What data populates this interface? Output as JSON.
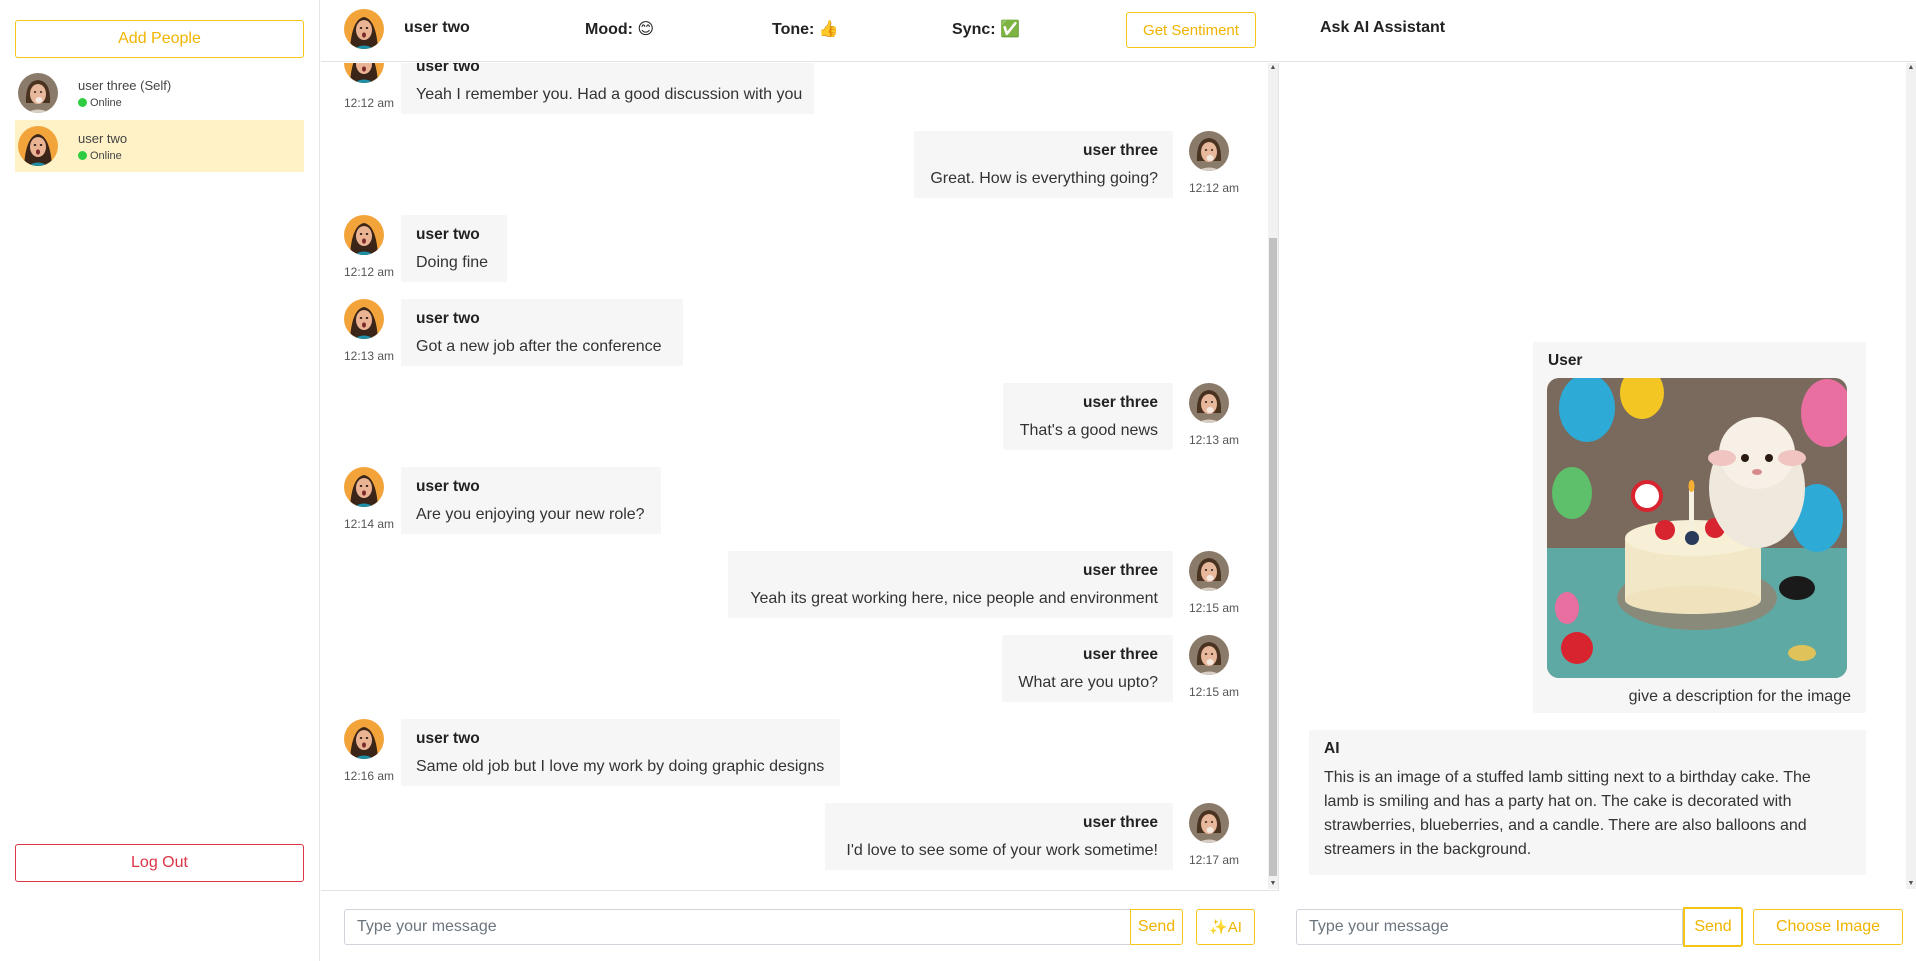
{
  "sidebar": {
    "add_people_label": "Add People",
    "logout_label": "Log Out",
    "contacts": [
      {
        "name": "user three (Self)",
        "status": "Online",
        "active": false
      },
      {
        "name": "user two",
        "status": "Online",
        "active": true
      }
    ]
  },
  "header": {
    "name": "user two",
    "mood": "Mood: 😊",
    "tone": "Tone: 👍",
    "sync": "Sync: ✅",
    "get_sentiment_label": "Get Sentiment",
    "ai_title": "Ask AI Assistant"
  },
  "messages": [
    {
      "sender": "user two",
      "text": "Yeah I remember you. Had a good discussion with you",
      "time": "12:12 am",
      "side": "left"
    },
    {
      "sender": "user three",
      "text": "Great. How is everything going?",
      "time": "12:12 am",
      "side": "right"
    },
    {
      "sender": "user two",
      "text": "Doing fine",
      "time": "12:12 am",
      "side": "left"
    },
    {
      "sender": "user two",
      "text": "Got a new job after the conference",
      "time": "12:13 am",
      "side": "left"
    },
    {
      "sender": "user three",
      "text": "That's a good news",
      "time": "12:13 am",
      "side": "right"
    },
    {
      "sender": "user two",
      "text": "Are you enjoying your new role?",
      "time": "12:14 am",
      "side": "left"
    },
    {
      "sender": "user three",
      "text": "Yeah its great working here, nice people and environment",
      "time": "12:15 am",
      "side": "right"
    },
    {
      "sender": "user three",
      "text": "What are you upto?",
      "time": "12:15 am",
      "side": "right"
    },
    {
      "sender": "user two",
      "text": "Same old job but I love my work by doing graphic designs",
      "time": "12:16 am",
      "side": "left"
    },
    {
      "sender": "user three",
      "text": "I'd love to see some of your work sometime!",
      "time": "12:17 am",
      "side": "right"
    }
  ],
  "composer": {
    "placeholder": "Type your message",
    "send_label": "Send",
    "ai_label": "✨AI"
  },
  "ai_panel": {
    "user_label": "User",
    "user_caption": "give a description for the image",
    "ai_label": "AI",
    "ai_response": "This is an image of a stuffed lamb sitting next to a birthday cake. The lamb is smiling and has a party hat on. The cake is decorated with strawberries, blueberries, and a candle. There are also balloons and streamers in the background.",
    "placeholder": "Type your message",
    "send_label": "Send",
    "choose_image_label": "Choose Image"
  },
  "colors": {
    "accent": "#f5c518",
    "active_contact": "#fff2c6",
    "online": "#2ecc40",
    "danger": "#dc3545",
    "bubble": "#f6f6f6"
  }
}
